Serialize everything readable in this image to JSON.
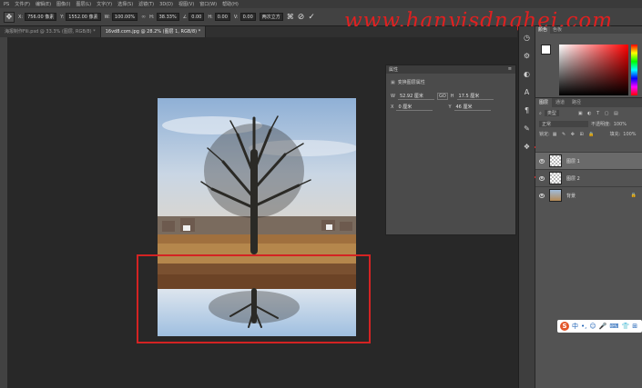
{
  "menu": [
    "PS",
    "文件(F)",
    "编辑(E)",
    "图像(I)",
    "图层(L)",
    "文字(Y)",
    "选择(S)",
    "滤镜(T)",
    "3D(D)",
    "视图(V)",
    "窗口(W)",
    "帮助(H)"
  ],
  "options": {
    "x_label": "X:",
    "x_value": "756.00 像素",
    "y_label": "Y:",
    "y_value": "1552.00 像素",
    "w_label": "W:",
    "w_value": "100.00%",
    "h_label": "H:",
    "h_value": "38.33%",
    "angle_value": "0.00",
    "hskew_label": "H:",
    "hskew_value": "0.00",
    "vskew_label": "V:",
    "vskew_value": "0.00",
    "interp_value": "两次立方"
  },
  "watermark": "www.hanyisdnghei.com",
  "tabs": [
    {
      "label": "海报制作Fili.psd @ 33.3% (图层, RGB/8) *"
    },
    {
      "label": "16vd8.com.jpg @ 28.2% (图层 1, RGB/8) *"
    }
  ],
  "properties": {
    "title": "属性",
    "subtitle": "变换图层属性",
    "w_value": "52.92 厘米",
    "h_value": "17.5 厘米",
    "x_value": "0 厘米",
    "y_value": "46 厘米",
    "link_label": "GO"
  },
  "color_panel": {
    "tab1": "颜色",
    "tab2": "色板"
  },
  "layers_panel": {
    "tabs": [
      "图层",
      "通道",
      "路径"
    ],
    "kind_label": "类型",
    "blend_mode": "正常",
    "opacity_label": "不透明度:",
    "opacity_value": "100%",
    "lock_label": "锁定:",
    "fill_label": "填充:",
    "fill_value": "100%",
    "layers": [
      {
        "name": "图层 1",
        "selected": true,
        "thumb": "checker"
      },
      {
        "name": "图层 2",
        "selected": false,
        "thumb": "checker"
      },
      {
        "name": "背景",
        "selected": false,
        "thumb": "photo"
      }
    ]
  },
  "ime": {
    "logo": "S",
    "lang": "中"
  },
  "colors": {
    "accent_red": "#d42323",
    "panel": "#535353",
    "canvas": "#282828"
  }
}
